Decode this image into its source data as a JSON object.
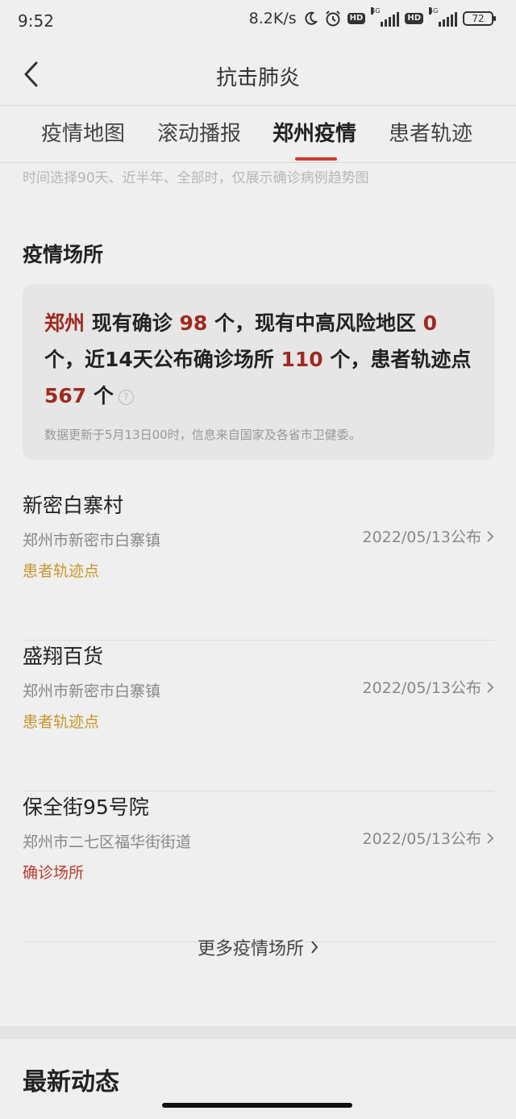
{
  "status_bar": {
    "time": "9:52",
    "network_speed": "8.2K/s",
    "hd1": "HD",
    "hd2": "HD",
    "net1": "4G",
    "net2": "4G",
    "battery": "72"
  },
  "header": {
    "title": "抗击肺炎"
  },
  "tabs": [
    {
      "label": "疫情地图"
    },
    {
      "label": "滚动播报"
    },
    {
      "label": "郑州疫情",
      "active": true
    },
    {
      "label": "患者轨迹"
    }
  ],
  "hint_text": "时间选择90天、近半年、全部时，仅展示确诊病例趋势图",
  "venues_section": {
    "title": "疫情场所",
    "summary": {
      "city": "郑州",
      "part1": " 现有确诊 ",
      "confirmed": "98",
      "part2": " 个，现有中高风险地区 ",
      "risk_areas": "0",
      "part3": " 个，近14天公布确诊场所 ",
      "venues": "110",
      "part4": " 个，患者轨迹点 ",
      "trace_points": "567",
      "part5": " 个",
      "help_icon": "?"
    },
    "update_note": "数据更新于5月13日00时，信息来自国家及各省市卫健委。"
  },
  "places": [
    {
      "name": "新密白寨村",
      "address": "郑州市新密市白寨镇",
      "date": "2022/05/13公布",
      "tag": "患者轨迹点",
      "tag_color": "#c9962b"
    },
    {
      "name": "盛翔百货",
      "address": "郑州市新密市白寨镇",
      "date": "2022/05/13公布",
      "tag": "患者轨迹点",
      "tag_color": "#c9962b"
    },
    {
      "name": "保全街95号院",
      "address": "郑州市二七区福华街街道",
      "date": "2022/05/13公布",
      "tag": "确诊场所",
      "tag_color": "#b93a2c"
    }
  ],
  "more_label": "更多疫情场所",
  "latest_section": {
    "title": "最新动态"
  },
  "colors": {
    "accent": "#d33a2c",
    "highlight": "#9e2a1f"
  }
}
